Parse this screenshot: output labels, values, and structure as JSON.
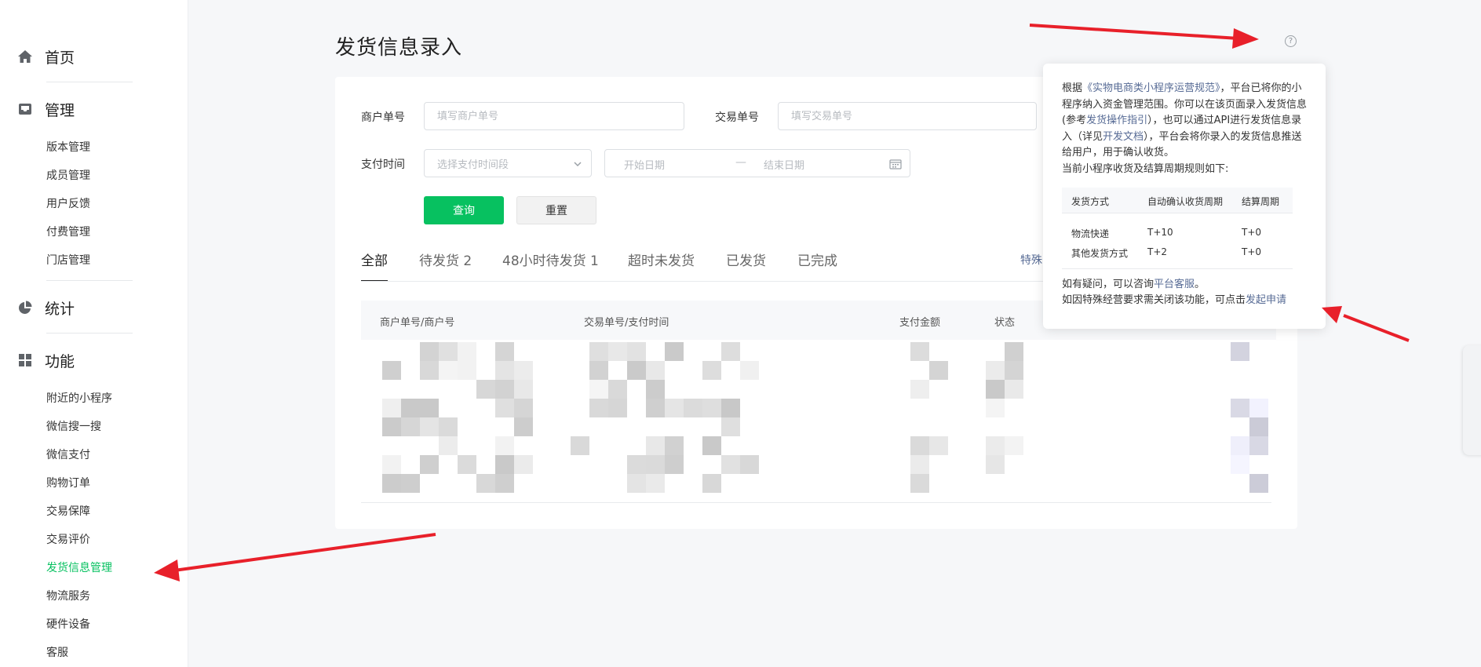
{
  "sidebar": {
    "home": "首页",
    "manage": {
      "label": "管理",
      "items": [
        "版本管理",
        "成员管理",
        "用户反馈",
        "付费管理",
        "门店管理"
      ]
    },
    "stats": "统计",
    "features": {
      "label": "功能",
      "items": [
        "附近的小程序",
        "微信搜一搜",
        "微信支付",
        "购物订单",
        "交易保障",
        "交易评价",
        "发货信息管理",
        "物流服务",
        "硬件设备",
        "客服"
      ]
    },
    "active_item": "发货信息管理",
    "accent_color": "#07c160"
  },
  "page": {
    "title": "发货信息录入"
  },
  "filters": {
    "merchant_label": "商户单号",
    "merchant_placeholder": "填写商户单号",
    "trade_label": "交易单号",
    "trade_placeholder": "填写交易单号",
    "paytime_label": "支付时间",
    "paytime_select": "选择支付时间段",
    "start_date": "开始日期",
    "date_sep": "—",
    "end_date": "结束日期",
    "query_button": "查询",
    "reset_button": "重置"
  },
  "tabs": [
    "全部",
    "待发货 2",
    "48小时待发货 1",
    "超时未发货",
    "已发货",
    "已完成"
  ],
  "special_link": "特殊",
  "table": {
    "headers": [
      "商户单号/商户号",
      "交易单号/支付时间",
      "支付金额",
      "状态"
    ]
  },
  "popover": {
    "p1": "根据",
    "p1_link": "《实物电商类小程序运营规范》",
    "p2": "，平台已将你的小程序纳入资金管理范围。你可以在该页面录入发货信息(参考",
    "p2_link": "发货操作指引",
    "p3": "），也可以通过API进行发货信息录入（详见",
    "p3_link": "开发文档",
    "p4": "），平台会将你录入的发货信息推送给用户，用于确认收货。",
    "p5": "当前小程序收货及结算周期规则如下:",
    "table": {
      "headers": [
        "发货方式",
        "自动确认收货周期",
        "结算周期"
      ],
      "rows": [
        [
          "物流快递",
          "T+10",
          "T+0"
        ],
        [
          "其他发货方式",
          "T+2",
          "T+0"
        ]
      ]
    },
    "foot1": "如有疑问，可以咨询",
    "foot1_link": "平台客服",
    "foot1_end": "。",
    "foot2": "如因特殊经营要求需关闭该功能，可点击",
    "foot2_link": "发起申请"
  },
  "help_icon": "?",
  "annotation_color": "#e8202a"
}
